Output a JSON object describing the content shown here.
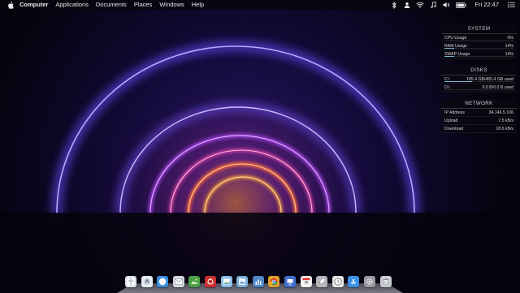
{
  "menubar": {
    "app_name": "Computer",
    "menus": [
      "Applications",
      "Documents",
      "Places",
      "Windows",
      "Help"
    ],
    "clock": "Fri 22:47",
    "status_icons": [
      "bluetooth-icon",
      "user-icon",
      "wifi-icon",
      "music-icon",
      "volume-icon",
      "battery-icon"
    ]
  },
  "conky": {
    "system": {
      "title": "SYSTEM",
      "rows": [
        {
          "label": "CPU Usage",
          "value": "0%",
          "level": 0
        },
        {
          "label": "RAM Usage",
          "value": "14%",
          "level": 0.14
        },
        {
          "label": "SWAP Usage",
          "value": "14%",
          "level": 0.14
        }
      ]
    },
    "disks": {
      "title": "DISKS",
      "rows": [
        {
          "label": "C:\\",
          "value": "185.4 GB/465.4 GB used",
          "level": 0.4
        },
        {
          "label": "D:\\",
          "value": "0.0 B/0.0 B used",
          "level": 0
        }
      ]
    },
    "network": {
      "title": "NETWORK",
      "rows": [
        {
          "label": "IP Address",
          "value": "34.146.5.106"
        },
        {
          "label": "Upload",
          "value": "7.5 kB/s"
        },
        {
          "label": "Download",
          "value": "18.6 kB/s"
        }
      ]
    }
  },
  "dock": {
    "items": [
      {
        "name": "finder",
        "color": "#dfe3ea"
      },
      {
        "name": "launchpad",
        "color": "#e8eef5"
      },
      {
        "name": "safari",
        "color": "#3a8fe0"
      },
      {
        "name": "mail",
        "color": "#d6dae0"
      },
      {
        "name": "photos",
        "color": "#4aa14a"
      },
      {
        "name": "ubuntu",
        "color": "#cc3030"
      },
      {
        "name": "preview",
        "color": "#8ac0e8"
      },
      {
        "name": "image-viewer",
        "color": "#7fb0d8"
      },
      {
        "name": "system-monitor",
        "color": "#4f86c6"
      },
      {
        "name": "chrome",
        "color": "#e0a030"
      },
      {
        "name": "keynote",
        "color": "#3f6fd0"
      },
      {
        "name": "calendar",
        "color": "#f2f2f2"
      },
      {
        "name": "rocket",
        "color": "#b5b5bd"
      },
      {
        "name": "clock",
        "color": "#eaeaea"
      },
      {
        "name": "app-store",
        "color": "#3a90e5"
      },
      {
        "name": "settings",
        "color": "#9a9aa2"
      },
      {
        "name": "trash",
        "color": "#c9ccd2"
      }
    ]
  }
}
